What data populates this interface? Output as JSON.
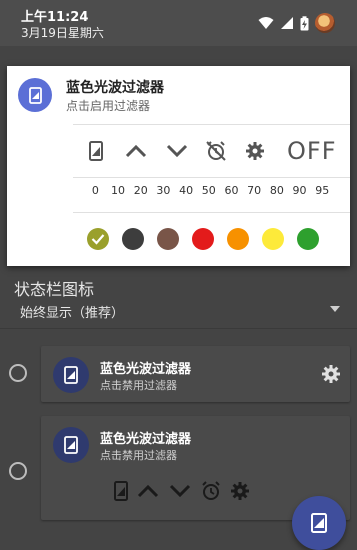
{
  "statusbar": {
    "time": "上午11:24",
    "date": "3月19日星期六"
  },
  "notification": {
    "title": "蓝色光波过滤器",
    "subtitle": "点击启用过滤器",
    "power_label": "OFF",
    "levels": [
      "0",
      "10",
      "20",
      "30",
      "40",
      "50",
      "60",
      "70",
      "80",
      "90",
      "95"
    ],
    "colors": [
      "#9aa02c",
      "#3d3d3d",
      "#795548",
      "#e31b1b",
      "#f79100",
      "#fdea3a",
      "#2ea02e"
    ],
    "selected_color_index": 0
  },
  "app": {
    "section_title": "状态栏图标",
    "section_value": "始终显示（推荐）",
    "filters": [
      {
        "name": "蓝色光波过滤器",
        "subtitle": "点击禁用过滤器"
      },
      {
        "name": "蓝色光波过滤器",
        "subtitle": "点击禁用过滤器"
      }
    ]
  },
  "colors": {
    "accent": "#5b6fd6",
    "fab": "#3f4e9c"
  }
}
